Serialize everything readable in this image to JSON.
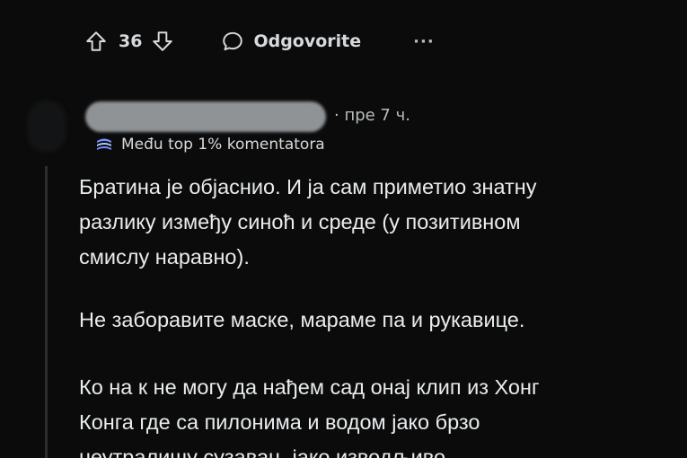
{
  "actions": {
    "upvote_icon": "arrow-up-outline-icon",
    "vote_count": "36",
    "downvote_icon": "arrow-down-outline-icon",
    "reply_icon": "speech-bubble-icon",
    "reply_label": "Odgovorite",
    "more_label": "···"
  },
  "comment": {
    "timestamp": "· пре 7 ч.",
    "flair_icon": "top-commenter-badge-icon",
    "flair_text": "Među top 1% komentatora",
    "paragraphs": [
      [
        "Братина је објаснио. И ја сам приметио знатну",
        "разлику између синоћ и среде (у позитивном",
        "смислу наравно)."
      ],
      [
        "Не заборавите маске, мараме па и рукавице."
      ],
      [
        "Ко на к не могу да нађем сад онај клип из Хонг",
        "Конга где са пилонима и водом јако брзо",
        "неутралишу сузавац, јако изводљиво"
      ]
    ]
  },
  "colors": {
    "background": "#0b0b0b",
    "text": "#d7dadc",
    "muted": "#b8bcbf",
    "thread_line": "#2b2d2f",
    "badge_accent": "#7193ff"
  }
}
